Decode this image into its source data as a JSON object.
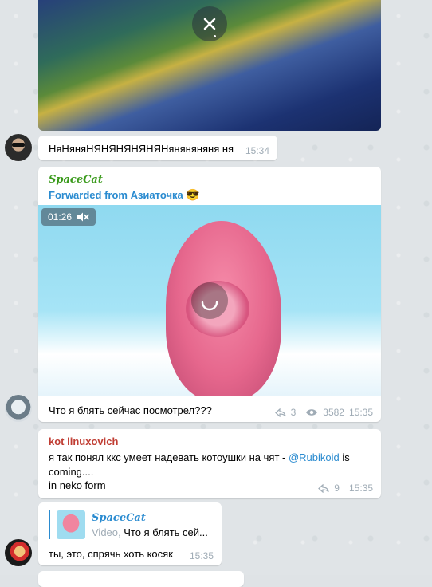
{
  "media_top": {
    "close_icon": "close-icon"
  },
  "msg1": {
    "text": "НяНяняНЯНЯНЯНЯНЯНяняняняня ня",
    "time": "15:34"
  },
  "msg2": {
    "author": "SpaceCat",
    "forwarded_prefix": "Forwarded from ",
    "forwarded_name": "Азиаточка",
    "emoji": "😎",
    "duration": "01:26",
    "caption": "Что я блять сейчас посмотрел???",
    "replies": "3",
    "views": "3582",
    "time": "15:35"
  },
  "msg3": {
    "author": "kot linuxovich",
    "text_before": "я так понял ккс умеет надевать котоушки на чят - ",
    "mention": "@Rubikoid",
    "text_after": " is coming....",
    "line2": "in neko form",
    "replies": "9",
    "time": "15:35"
  },
  "msg4": {
    "reply_author": "SpaceCat",
    "reply_type": "Video,",
    "reply_text": " Что я блять сей...",
    "text": "ты, это, спрячь хоть косяк",
    "time": "15:35"
  },
  "colors": {
    "accent": "#2a8bd0",
    "kot_name": "#c03d33",
    "spacecat_name": "#3a9a1b",
    "meta": "#a0acb6"
  }
}
